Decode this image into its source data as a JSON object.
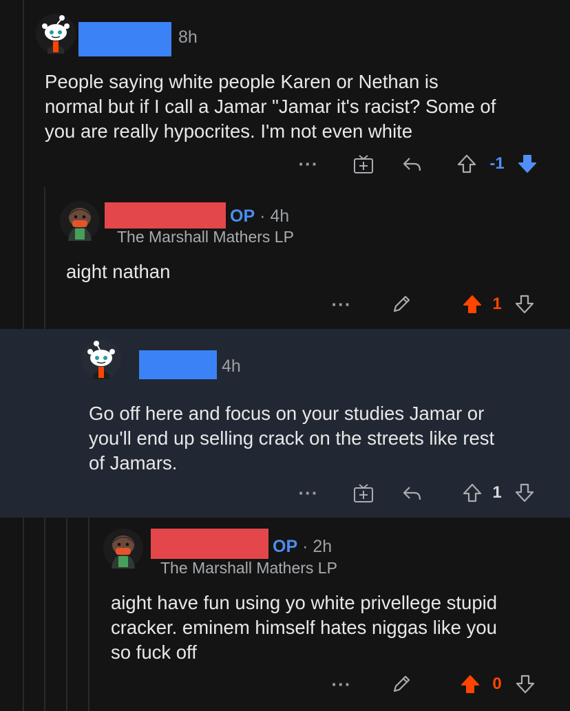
{
  "comments": [
    {
      "time": "8h",
      "op": "",
      "flair": "",
      "text": [
        "People saying white people Karen or Nethan is",
        "normal but if I call a Jamar \"Jamar it's racist? Some of",
        "you are really hypocrites. I'm not even white"
      ],
      "score": "-1",
      "vote": "down"
    },
    {
      "time": "4h",
      "op": "OP",
      "dot": "·",
      "flair": "The Marshall Mathers LP",
      "text": [
        "aight nathan"
      ],
      "score": "1",
      "vote": "up"
    },
    {
      "time": "4h",
      "op": "",
      "flair": "",
      "text": [
        "Go off here and focus on your studies Jamar or",
        "you'll end up selling crack on the streets like rest",
        "of Jamars."
      ],
      "score": "1",
      "vote": "none"
    },
    {
      "time": "2h",
      "op": "OP",
      "dot": "·",
      "flair": "The Marshall Mathers LP",
      "text": [
        "aight have fun using yo white privellege stupid",
        "cracker. eminem himself hates niggas like you",
        "so fuck off"
      ],
      "score": "0",
      "vote": "up"
    }
  ],
  "icons": {
    "more": "···",
    "award": "award-icon",
    "reply": "reply-icon",
    "edit": "edit-icon",
    "upvote": "upvote-icon",
    "downvote": "downvote-icon"
  },
  "colors": {
    "background": "#141414",
    "highlight": "#222833",
    "op": "#4c8ef0",
    "upvote": "#ff4500",
    "downvote": "#4f8ff7",
    "redact_blue": "#3b82f6",
    "redact_red": "#e4474b"
  }
}
